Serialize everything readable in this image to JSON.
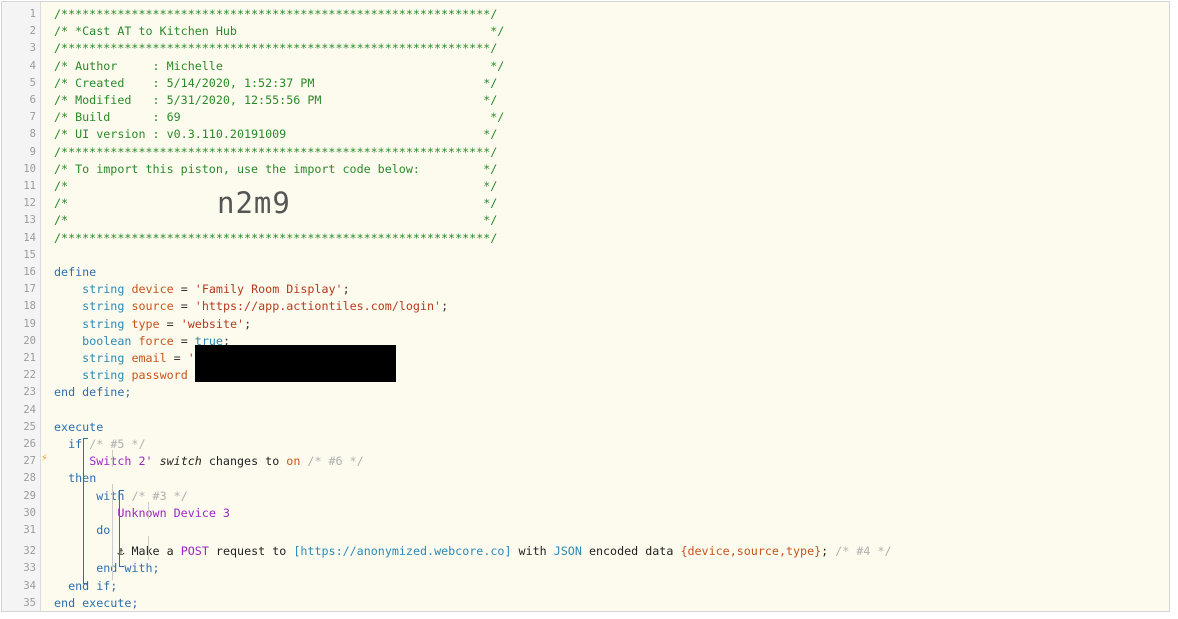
{
  "header": {
    "border": "/*************************************************************/",
    "title": "/* *Cast AT to Kitchen Hub                                    */",
    "author": "/* Author     : Michelle                                      */",
    "created": "/* Created    : 5/14/2020, 1:52:37 PM                        */",
    "modified": "/* Modified   : 5/31/2020, 12:55:56 PM                       */",
    "build": "/* Build      : 69                                            */",
    "ui_version": "/* UI version : v0.3.110.20191009                            */",
    "import_note": "/* To import this piston, use the import code below:         */",
    "blank": "/*                                                           */",
    "import_code": "n2m9"
  },
  "line_numbers": [
    "1",
    "2",
    "3",
    "4",
    "5",
    "6",
    "7",
    "8",
    "9",
    "10",
    "11",
    "12",
    "13",
    "14",
    "15",
    "16",
    "17",
    "18",
    "19",
    "20",
    "21",
    "22",
    "23",
    "24",
    "25",
    "26",
    "27",
    "28",
    "29",
    "30",
    "31",
    "32",
    "33",
    "34",
    "35"
  ],
  "define": {
    "kw": "define",
    "end": "end define;",
    "vars": [
      {
        "type": "string",
        "name": "device",
        "eq": " = ",
        "value": "'Family Room Display'",
        "tail": ";"
      },
      {
        "type": "string",
        "name": "source",
        "eq": " = ",
        "value": "'https://app.actiontiles.com/login'",
        "tail": ";"
      },
      {
        "type": "string",
        "name": "type",
        "eq": " = ",
        "value": "'website'",
        "tail": ";"
      },
      {
        "type": "boolean",
        "name": "force",
        "eq": " = ",
        "value": "true",
        "tail": ";"
      },
      {
        "type": "string",
        "name": "email",
        "eq": " = ",
        "value": "'",
        "tail": ""
      },
      {
        "type": "string",
        "name": "password",
        "eq": "",
        "value": "",
        "tail": ""
      }
    ]
  },
  "execute": {
    "kw": "execute",
    "if_kw": "if",
    "if_cmt": "/* #5 */",
    "cond_device": "Switch 2'",
    "cond_attr": "switch",
    "cond_op": "changes to",
    "cond_val": "on",
    "cond_cmt": "/* #6 */",
    "then_kw": "then",
    "with_kw": "with",
    "with_cmt": "/* #3 */",
    "with_device": "Unknown Device 3",
    "do_kw": "do",
    "anchor": "⚓",
    "action_a": "Make a",
    "action_method": "POST",
    "action_b": "request to",
    "action_url": "[https://anonymized.webcore.co]",
    "action_c": "with",
    "action_fmt": "JSON",
    "action_d": "encoded data",
    "action_vars": "{device,source,type}",
    "action_semi": ";",
    "action_cmt": "/* #4 */",
    "end_with": "end with;",
    "end_if": "end if;",
    "end": "end execute;"
  }
}
